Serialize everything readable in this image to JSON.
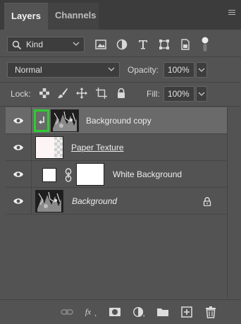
{
  "tabs": [
    {
      "label": "Layers",
      "active": true
    },
    {
      "label": "Channels",
      "active": false
    }
  ],
  "filter": {
    "kind_label": "Kind",
    "icons": [
      "image-filter-icon",
      "adjustment-filter-icon",
      "type-filter-icon",
      "shape-filter-icon",
      "smart-object-filter-icon"
    ]
  },
  "blend": {
    "mode": "Normal",
    "opacity_label": "Opacity:",
    "opacity_value": "100%"
  },
  "lock": {
    "label": "Lock:",
    "fill_label": "Fill:",
    "fill_value": "100%"
  },
  "layers": [
    {
      "name": "Background copy",
      "selected": true,
      "clipped": true
    },
    {
      "name": "Paper Texture",
      "selected": false
    },
    {
      "name": "White Background",
      "selected": false,
      "has_mask": true
    },
    {
      "name": "Background",
      "selected": false,
      "locked": true
    }
  ],
  "colors": {
    "panel_bg": "#535353",
    "selected_row": "#6a6a6a",
    "highlight": "#2ecc2e"
  },
  "footer_icons": [
    "link-layers-icon",
    "fx-icon",
    "add-mask-icon",
    "adjustment-layer-icon",
    "new-group-icon",
    "new-layer-icon",
    "delete-layer-icon"
  ]
}
